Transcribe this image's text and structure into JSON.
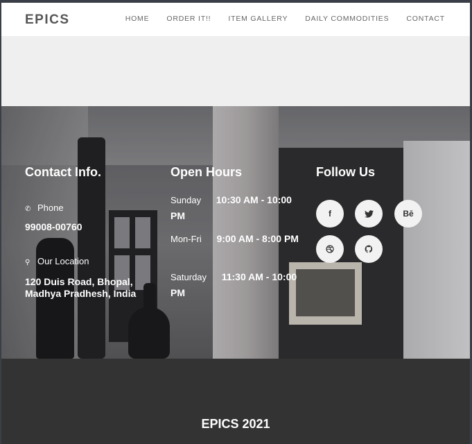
{
  "brand": "EPICS",
  "nav": [
    "HOME",
    "ORDER IT!!",
    "ITEM GALLERY",
    "DAILY COMMODITIES",
    "CONTACT"
  ],
  "contact": {
    "title": "Contact Info.",
    "phone_label": "Phone",
    "phone": "99008-00760",
    "location_label": "Our Location",
    "address": "120 Duis Road, Bhopal, Madhya Pradhesh, India"
  },
  "hours": {
    "title": "Open Hours",
    "rows": [
      {
        "day": "Sunday",
        "time": "10:30 AM - 10:00 PM"
      },
      {
        "day": "Mon-Fri",
        "time": "9:00 AM - 8:00 PM"
      },
      {
        "day": "Saturday",
        "time": "11:30 AM - 10:00 PM"
      }
    ]
  },
  "follow": {
    "title": "Follow Us",
    "icons": [
      "facebook-icon",
      "twitter-icon",
      "behance-icon",
      "dribbble-icon",
      "github-icon"
    ],
    "glyphs": [
      "f",
      "🐦",
      "Bē",
      "⚽",
      "🐙"
    ]
  },
  "footer": {
    "title": "EPICS 2021"
  }
}
